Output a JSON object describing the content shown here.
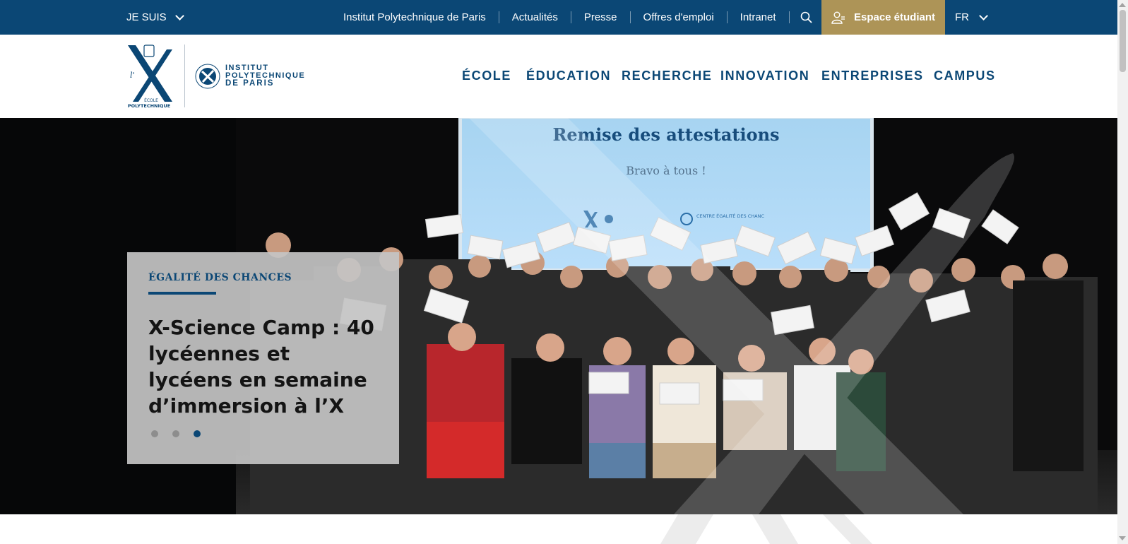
{
  "topbar": {
    "audience_label": "JE SUIS",
    "links": [
      "Institut Polytechnique de Paris",
      "Actualités",
      "Presse",
      "Offres d'emploi",
      "Intranet"
    ],
    "student_label": "Espace étudiant",
    "lang_label": "FR"
  },
  "logo": {
    "x_letter": "X",
    "school_line1": "ÉCOLE",
    "school_line2": "POLYTECHNIQUE",
    "ipp_line1": "INSTITUT",
    "ipp_line2": "POLYTECHNIQUE",
    "ipp_line3": "DE PARIS"
  },
  "nav": [
    "ÉCOLE",
    "ÉDUCATION",
    "RECHERCHE",
    "INNOVATION",
    "ENTREPRISES",
    "CAMPUS"
  ],
  "hero": {
    "screen_title": "Remise des attestations",
    "screen_subtitle": "Bravo à tous !",
    "screen_logo_text": "CENTRE ÉGALITÉ DES CHANCES",
    "card": {
      "category": "ÉGALITÉ DES CHANCES",
      "title": "X-Science Camp : 40 lycéennes et lycéens en semaine d’immersion à l’X"
    },
    "slides_total": 3,
    "active_slide": 3
  },
  "colors": {
    "brand_blue": "#0b4775",
    "gold": "#ad9457"
  }
}
